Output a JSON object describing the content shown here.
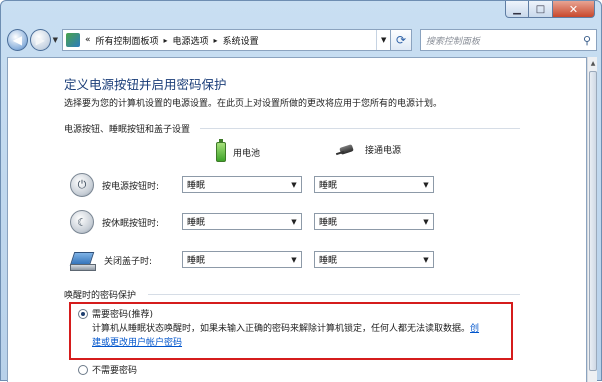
{
  "window": {
    "caption_buttons": {
      "minimize": "▁",
      "maximize": "□",
      "close": "✕"
    }
  },
  "nav": {
    "back_icon": "back-arrow-icon",
    "forward_icon": "forward-arrow-icon",
    "breadcrumb_prefix": "«",
    "breadcrumb": [
      "所有控制面板项",
      "电源选项",
      "系统设置"
    ],
    "crumb_separator": "▸",
    "search_placeholder": "搜索控制面板"
  },
  "page": {
    "title": "定义电源按钮并启用密码保护",
    "description": "选择要为您的计算机设置的电源设置。在此页上对设置所做的更改将应用于您所有的电源计划。"
  },
  "power_buttons": {
    "group_title": "电源按钮、睡眠按钮和盖子设置",
    "columns": [
      "用电池",
      "接通电源"
    ],
    "rows": [
      {
        "label": "按电源按钮时:",
        "battery": "睡眠",
        "plugged_in": "睡眠",
        "icon": "power-button-icon"
      },
      {
        "label": "按休眠按钮时:",
        "battery": "睡眠",
        "plugged_in": "睡眠",
        "icon": "sleep-button-icon"
      },
      {
        "label": "关闭盖子时:",
        "battery": "睡眠",
        "plugged_in": "睡眠",
        "icon": "laptop-lid-icon"
      }
    ]
  },
  "password": {
    "group_title": "唤醒时的密码保护",
    "require_label": "需要密码(推荐)",
    "require_selected": true,
    "description_lines": [
      "计算机从睡眠状态唤醒时，如果未输入正确的密码来解除计算机锁定，任何人都无法读取数据。",
      "建或更改用户帐户密码"
    ],
    "link_start": "创",
    "link_text": "建或更改用户帐户密码",
    "no_password_label": "不需要密码",
    "no_password_selected": false
  },
  "colors": {
    "title_blue": "#1a3d78",
    "link_blue": "#0055cc",
    "highlight_red": "#d51c1c"
  }
}
